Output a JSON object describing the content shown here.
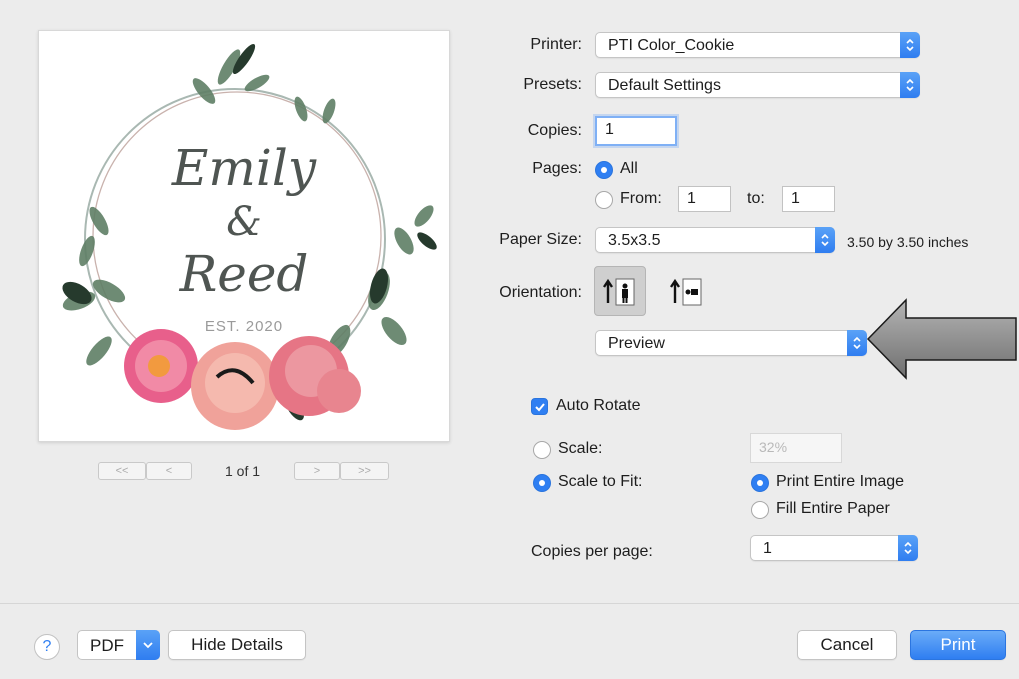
{
  "preview": {
    "line1": "Emily",
    "line2": "&",
    "line3": "Reed",
    "est": "EST. 2020",
    "page_indicator": "1 of 1",
    "first_page": "<<",
    "prev_page": "<",
    "next_page": ">",
    "last_page": ">>"
  },
  "printer": {
    "label": "Printer:",
    "value": "PTI Color_Cookie"
  },
  "presets": {
    "label": "Presets:",
    "value": "Default Settings"
  },
  "copies": {
    "label": "Copies:",
    "value": "1"
  },
  "pages": {
    "label": "Pages:",
    "all_label": "All",
    "from_label": "From:",
    "from_value": "1",
    "to_label": "to:",
    "to_value": "1",
    "selected": "All"
  },
  "paper_size": {
    "label": "Paper Size:",
    "value": "3.5x3.5",
    "dimensions": "3.50 by 3.50 inches"
  },
  "orientation": {
    "label": "Orientation:",
    "selected": "portrait"
  },
  "section_menu": {
    "value": "Preview"
  },
  "auto_rotate": {
    "label": "Auto Rotate",
    "checked": true
  },
  "scale": {
    "label": "Scale:",
    "value": "32%"
  },
  "scale_to_fit": {
    "label": "Scale to Fit:",
    "selected": true
  },
  "fit_options": {
    "print_entire": "Print Entire Image",
    "fill_entire": "Fill Entire Paper",
    "selected": "Print Entire Image"
  },
  "copies_per_page": {
    "label": "Copies per page:",
    "value": "1"
  },
  "footer": {
    "help": "?",
    "pdf": "PDF",
    "hide_details": "Hide Details",
    "cancel": "Cancel",
    "print": "Print"
  },
  "colors": {
    "accent": "#2f7ff2",
    "callout_arrow": "#8e8e8e",
    "panel_background": "#ececec"
  },
  "icons": {
    "popup_stepper": "up-down-chevron-icon",
    "portrait": "portrait-orientation-icon",
    "landscape": "landscape-orientation-icon",
    "callout": "pointer-arrow-icon"
  }
}
